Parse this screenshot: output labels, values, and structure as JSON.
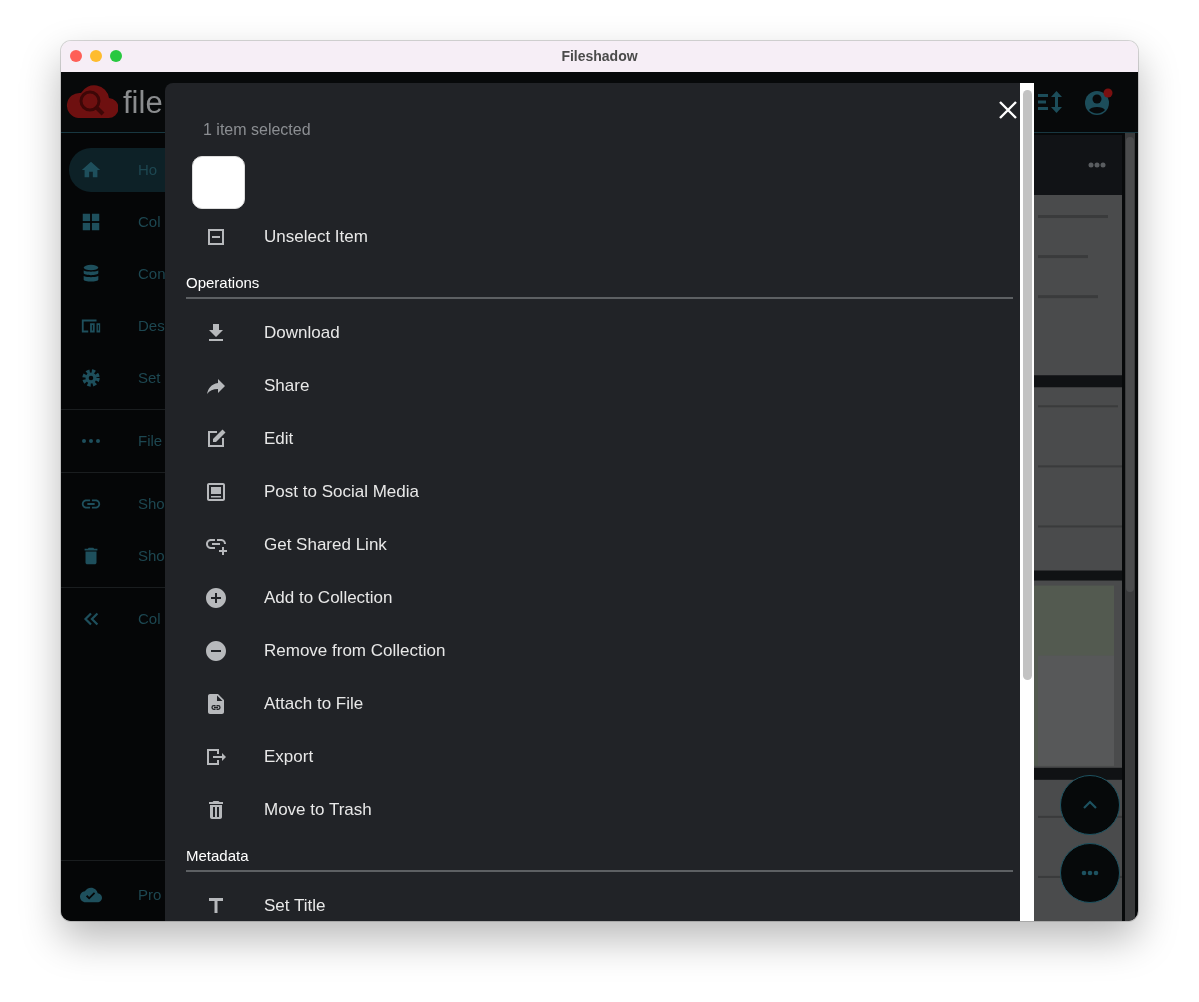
{
  "window": {
    "title": "Fileshadow"
  },
  "app": {
    "logo_text": "file",
    "sidebar": {
      "groups": [
        [
          {
            "label": "Ho",
            "selected": true
          },
          {
            "label": "Col",
            "selected": false
          },
          {
            "label": "Con",
            "selected": false
          },
          {
            "label": "Des",
            "selected": false
          },
          {
            "label": "Set",
            "selected": false
          }
        ],
        [
          {
            "label": "File",
            "selected": false
          }
        ],
        [
          {
            "label": "Sho",
            "selected": false
          },
          {
            "label": "Sho",
            "selected": false
          }
        ],
        [
          {
            "label": "Col",
            "selected": false
          }
        ]
      ],
      "footer": {
        "label": "Pro",
        "selected": false
      }
    }
  },
  "dialog": {
    "heading": "1 item selected",
    "unselect": {
      "label": "Unselect Item"
    },
    "sections": [
      {
        "title": "Operations",
        "items": [
          {
            "label": "Download"
          },
          {
            "label": "Share"
          },
          {
            "label": "Edit"
          },
          {
            "label": "Post to Social Media"
          },
          {
            "label": "Get Shared Link"
          },
          {
            "label": "Add to Collection"
          },
          {
            "label": "Remove from Collection"
          },
          {
            "label": "Attach to File"
          },
          {
            "label": "Export"
          },
          {
            "label": "Move to Trash"
          }
        ]
      },
      {
        "title": "Metadata",
        "items": [
          {
            "label": "Set Title"
          }
        ]
      }
    ]
  }
}
